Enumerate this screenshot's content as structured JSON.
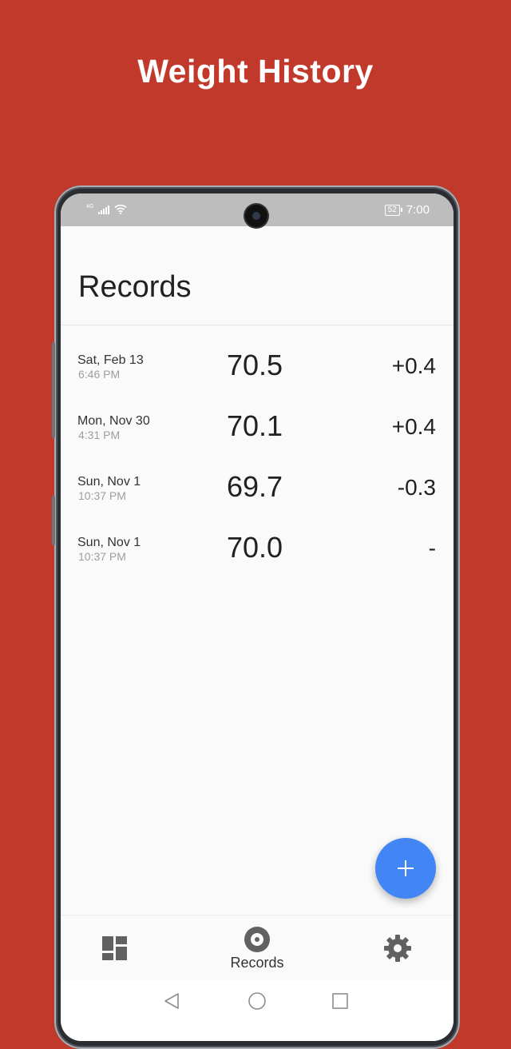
{
  "promo": {
    "title": "Weight History"
  },
  "status_bar": {
    "network": "4G",
    "battery": "52",
    "time": "7:00"
  },
  "page": {
    "title": "Records"
  },
  "records": [
    {
      "date": "Sat, Feb 13",
      "time": "6:46 PM",
      "weight": "70.5",
      "change": "+0.4"
    },
    {
      "date": "Mon, Nov 30",
      "time": "4:31 PM",
      "weight": "70.1",
      "change": "+0.4"
    },
    {
      "date": "Sun, Nov 1",
      "time": "10:37 PM",
      "weight": "69.7",
      "change": "-0.3"
    },
    {
      "date": "Sun, Nov 1",
      "time": "10:37 PM",
      "weight": "70.0",
      "change": "-"
    }
  ],
  "fab": {
    "icon": "plus-icon"
  },
  "bottom_nav": {
    "items": [
      {
        "icon": "dashboard-icon",
        "label": ""
      },
      {
        "icon": "record-icon",
        "label": "Records"
      },
      {
        "icon": "gear-icon",
        "label": ""
      }
    ]
  },
  "colors": {
    "background": "#c0392b",
    "accent": "#4285f4",
    "status_bar": "#bdbdbd"
  }
}
